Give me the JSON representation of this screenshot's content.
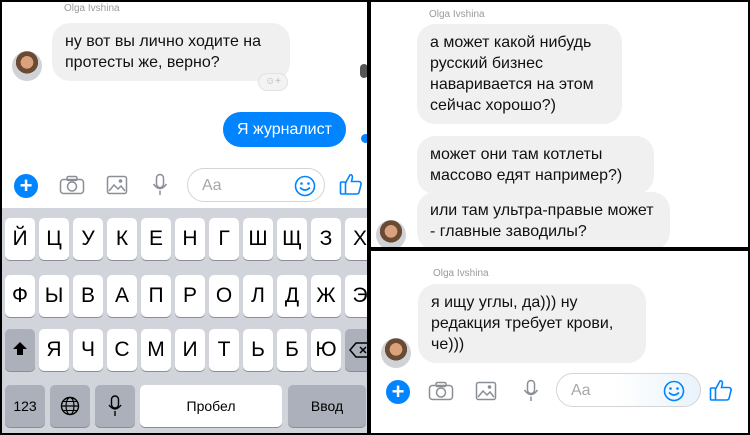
{
  "left": {
    "sender": "Olga Ivshina",
    "incoming": "ну вот вы лично ходите на протесты же, верно?",
    "outgoing": "Я журналист",
    "placeholder": "Aa"
  },
  "keyboard": {
    "row1": [
      "Й",
      "Ц",
      "У",
      "К",
      "Е",
      "Н",
      "Г",
      "Ш",
      "Щ",
      "З",
      "Х"
    ],
    "row2": [
      "Ф",
      "Ы",
      "В",
      "А",
      "П",
      "Р",
      "О",
      "Л",
      "Д",
      "Ж",
      "Э"
    ],
    "row3": [
      "Я",
      "Ч",
      "С",
      "М",
      "И",
      "Т",
      "Ь",
      "Б",
      "Ю"
    ],
    "numbers_label": "123",
    "space_label": "Пробел",
    "return_label": "Ввод"
  },
  "top_right": {
    "sender": "Olga Ivshina",
    "messages": [
      "а может какой нибудь русский бизнес наваривается на этом сейчас хорошо?)",
      "может они там котлеты массово едят например?)",
      "или там ультра-правые может - главные заводилы?"
    ]
  },
  "bottom_right": {
    "sender": "Olga Ivshina",
    "message": "я ищу углы, да))) ну редакция требует крови, че)))",
    "placeholder": "Aa"
  },
  "colors": {
    "accent": "#0084ff",
    "bubble_in": "#f0f0f0",
    "keyboard_bg": "#d1d4da"
  },
  "icons": [
    "plus-icon",
    "camera-icon",
    "image-icon",
    "microphone-icon",
    "smiley-icon",
    "thumbs-up-icon",
    "globe-icon",
    "shift-icon",
    "backspace-icon"
  ]
}
